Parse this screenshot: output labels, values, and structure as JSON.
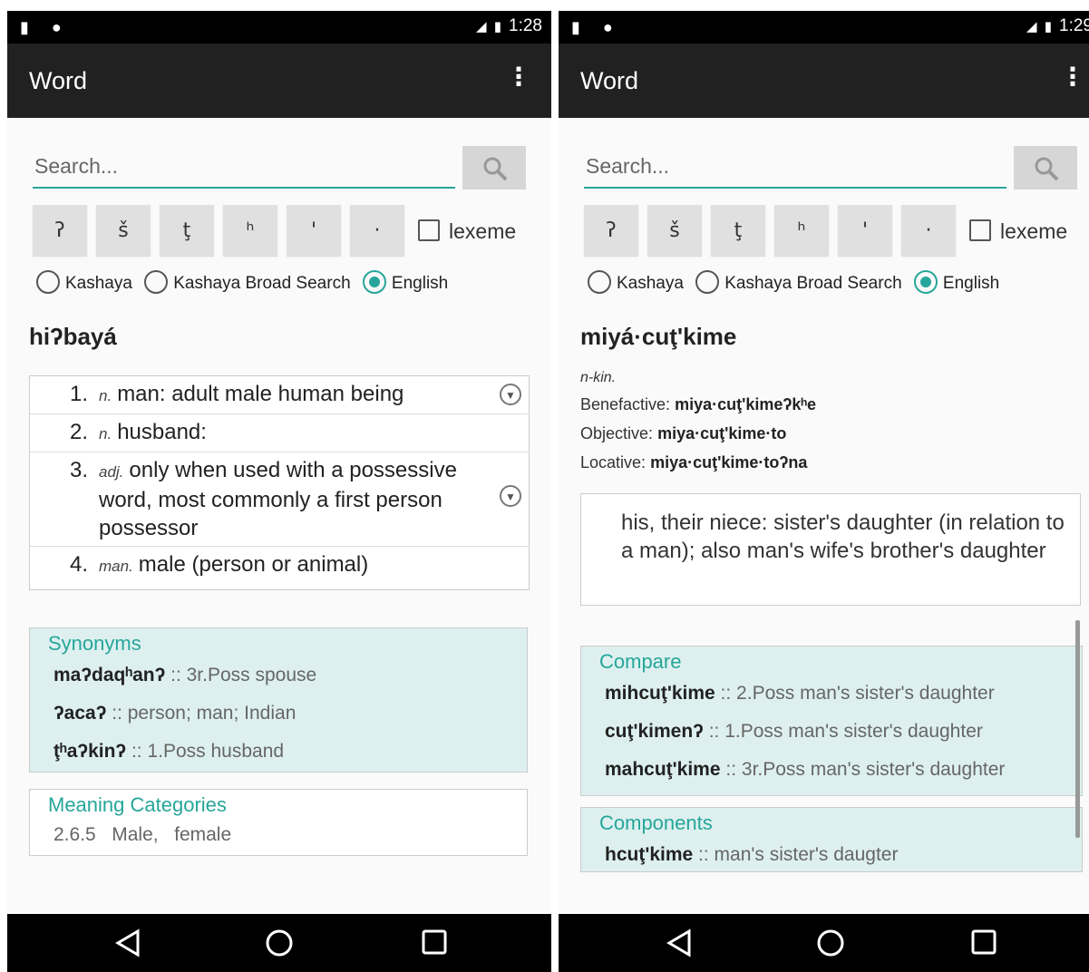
{
  "left": {
    "status": {
      "time": "1:28"
    },
    "appbar": {
      "title": "Word"
    },
    "search": {
      "placeholder": "Search..."
    },
    "keys": [
      "ʔ",
      "š",
      "ţ",
      "ʰ",
      "'",
      "·"
    ],
    "lexeme_label": "lexeme",
    "radios": [
      {
        "label": "Kashaya",
        "selected": false
      },
      {
        "label": "Kashaya Broad Search",
        "selected": false
      },
      {
        "label": "English",
        "selected": true
      }
    ],
    "headword": "hiʔbayá",
    "senses": [
      {
        "num": "1.",
        "pos": "n.",
        "text": "man: adult male human being"
      },
      {
        "num": "2.",
        "pos": "n.",
        "text": "husband:"
      },
      {
        "num": "3.",
        "pos": "adj.",
        "text": "only when used with a possessive word, most commonly a first person possessor"
      },
      {
        "num": "4.",
        "pos": "man.",
        "text": "male (person or animal)"
      }
    ],
    "synonyms": {
      "header": "Synonyms",
      "items": [
        {
          "word": "maʔdaqʰanʔ",
          "gloss": ":: 3r.Poss spouse"
        },
        {
          "word": "ʔacaʔ",
          "gloss": ":: person; man; Indian"
        },
        {
          "word": "ţʰaʔkinʔ",
          "gloss": ":: 1.Poss husband"
        }
      ]
    },
    "categories": {
      "header": "Meaning Categories",
      "items": [
        "2.6.5",
        "Male,",
        "female"
      ]
    }
  },
  "right": {
    "status": {
      "time": "1:29"
    },
    "appbar": {
      "title": "Word"
    },
    "search": {
      "placeholder": "Search..."
    },
    "keys": [
      "ʔ",
      "š",
      "ţ",
      "ʰ",
      "'",
      "·"
    ],
    "lexeme_label": "lexeme",
    "radios": [
      {
        "label": "Kashaya",
        "selected": false
      },
      {
        "label": "Kashaya Broad Search",
        "selected": false
      },
      {
        "label": "English",
        "selected": true
      }
    ],
    "headword": "miyá·cuţ'kime",
    "subtitle": "n-kin.",
    "forms": [
      {
        "label": "Benefactive:",
        "value": "miya·cuţ'kimeʔkʰe"
      },
      {
        "label": "Objective:",
        "value": "miya·cuţ'kime·to"
      },
      {
        "label": "Locative:",
        "value": "miya·cuţ'kime·toʔna"
      }
    ],
    "definition": "his, their niece: sister's daughter (in relation to a man); also man's wife's brother's daughter",
    "compare": {
      "header": "Compare",
      "items": [
        {
          "word": "mihcuţ'kime",
          "gloss": ":: 2.Poss man's sister's daughter"
        },
        {
          "word": "cuţ'kimenʔ",
          "gloss": ":: 1.Poss man's sister's daughter"
        },
        {
          "word": "mahcuţ'kime",
          "gloss": ":: 3r.Poss man's sister's daughter"
        }
      ]
    },
    "components": {
      "header": "Components",
      "items": [
        {
          "word": "hcuţ'kime",
          "gloss": ":: man's sister's daugter"
        }
      ]
    }
  }
}
